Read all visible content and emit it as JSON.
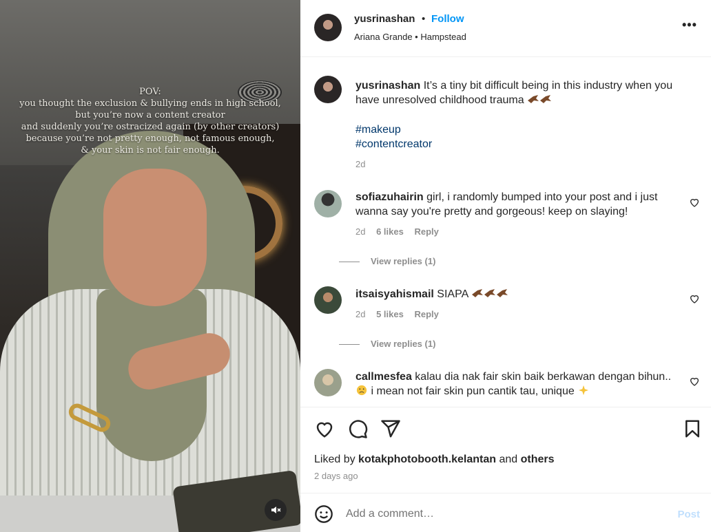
{
  "media": {
    "caption_lines": [
      "POV:",
      "you thought the exclusion & bullying ends in high school,",
      "but you’re now a content creator",
      "and suddenly you’re ostracized again (by other creators)",
      "because you’re not pretty enough, not famous enough,",
      "& your skin is not fair enough."
    ],
    "mute_icon": "muted-speaker-icon"
  },
  "header": {
    "username": "yusrinashan",
    "separator": "•",
    "follow_label": "Follow",
    "subtitle": "Ariana Grande • Hampstead",
    "more_label": "•••"
  },
  "caption": {
    "username": "yusrinashan",
    "text": "It’s a tiny bit difficult being in this industry when you have unresolved childhood trauma",
    "emoji": "bird-emoji x2",
    "hashtags": [
      "#makeup",
      "#contentcreator"
    ],
    "time": "2d"
  },
  "comments": [
    {
      "username": "sofiazuhairin",
      "text": "girl, i randomly bumped into your post and i just wanna say you're pretty and gorgeous! keep on slaying!",
      "time": "2d",
      "likes": "6 likes",
      "reply": "Reply",
      "view_replies": "View replies (1)"
    },
    {
      "username": "itsaisyahismail",
      "text": "SIAPA",
      "emoji": "bird-emoji x3",
      "time": "2d",
      "likes": "5 likes",
      "reply": "Reply",
      "view_replies": "View replies (1)"
    },
    {
      "username": "callmesfea",
      "text_a": "kalau dia nak fair skin baik berkawan dengan bihun..",
      "text_b": "i mean not fair skin pun cantik tau, unique",
      "emoji": [
        "frowning-face-emoji",
        "sparkles-emoji"
      ]
    }
  ],
  "actions": {
    "icons": [
      "heart-icon",
      "comment-icon",
      "share-icon",
      "bookmark-icon"
    ],
    "liked_prefix": "Liked by",
    "liked_user": "kotakphotobooth.kelantan",
    "liked_and": "and",
    "liked_others": "others",
    "time_ago": "2 days ago"
  },
  "add_comment": {
    "placeholder": "Add a comment…",
    "post_label": "Post"
  },
  "colors": {
    "link_blue": "#0095f6",
    "hashtag": "#00376b",
    "muted": "#8e8e8e",
    "post_disabled": "#c0dffd"
  }
}
